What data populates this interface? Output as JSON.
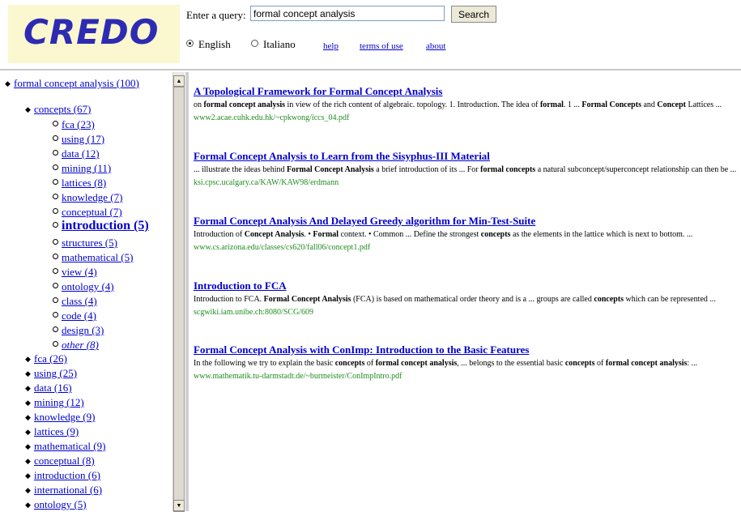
{
  "header": {
    "logo_text": "CREDO",
    "query_label": "Enter a query:",
    "query_value": "formal concept analysis",
    "search_label": "Search",
    "lang_en": "English",
    "lang_it": "Italiano",
    "help": "help",
    "terms": "terms of use",
    "about": "about"
  },
  "tree": {
    "root": "formal concept analysis (100)",
    "concepts": "concepts (67)",
    "children": [
      "fca (23)",
      "using (17)",
      "data (12)",
      "mining (11)",
      "lattices (8)",
      "knowledge (7)",
      "conceptual (7)",
      "introduction (5)",
      "structures (5)",
      "mathematical (5)",
      "view (4)",
      "ontology (4)",
      "class (4)",
      "code (4)",
      "design (3)",
      "other (8)"
    ],
    "siblings": [
      "fca (26)",
      "using (25)",
      "data (16)",
      "mining (12)",
      "knowledge (9)",
      "lattices (9)",
      "mathematical (9)",
      "conceptual (8)",
      "introduction (6)",
      "international (6)",
      "ontology (5)"
    ]
  },
  "results": [
    {
      "title": "A Topological Framework for Formal Concept Analysis",
      "snippet_html": "on <b>formal concept analysis</b> in view of the rich content of algebraic. topology. 1. Introduction. The idea of <b>formal</b>. 1 ... <b>Formal Concepts</b> and <b>Concept</b> Lattices ...",
      "url": "www2.acae.cuhk.edu.hk/~cpkwong/iccs_04.pdf"
    },
    {
      "title": "Formal Concept Analysis to Learn from the Sisyphus-III Material",
      "snippet_html": "... illustrate the ideas behind <b>Formal Concept Analysis</b> a brief introduction of its ... For <b>formal concepts</b> a natural subconcept/superconcept relationship can then be ...",
      "url": "ksi.cpsc.ucalgary.ca/KAW/KAW98/erdmann"
    },
    {
      "title": "Formal Concept Analysis And Delayed Greedy algorithm for Min-Test-Suite",
      "snippet_html": "Introduction of <b>Concept Analysis</b>. • <b>Formal</b> context. • Common ... Define the strongest <b>concepts</b> as the elements in the lattice which is next to bottom. ...",
      "url": "www.cs.arizona.edu/classes/cs620/fall06/concept1.pdf"
    },
    {
      "title": "Introduction to FCA",
      "snippet_html": "Introduction to FCA. <b>Formal Concept Analysis</b> (FCA) is based on mathematical order theory and is a ... groups are called <b>concepts</b> which can be represented ...",
      "url": "scgwiki.iam.unibe.ch:8080/SCG/609"
    },
    {
      "title": "Formal Concept Analysis with ConImp: Introduction to the Basic Features",
      "snippet_html": "In the following we try to explain the basic <b>concepts</b> of <b>formal concept analysis</b>, ... belongs to the essential basic <b>concepts</b> of <b>formal concept analysis</b>: ...",
      "url": "www.mathematik.tu-darmstadt.de/~burmeister/ConImpIntro.pdf"
    }
  ],
  "icons": {
    "scroll_up": "scroll-up-arrow-icon",
    "scroll_down": "scroll-down-arrow-icon",
    "bullet": "bullet-icon"
  }
}
